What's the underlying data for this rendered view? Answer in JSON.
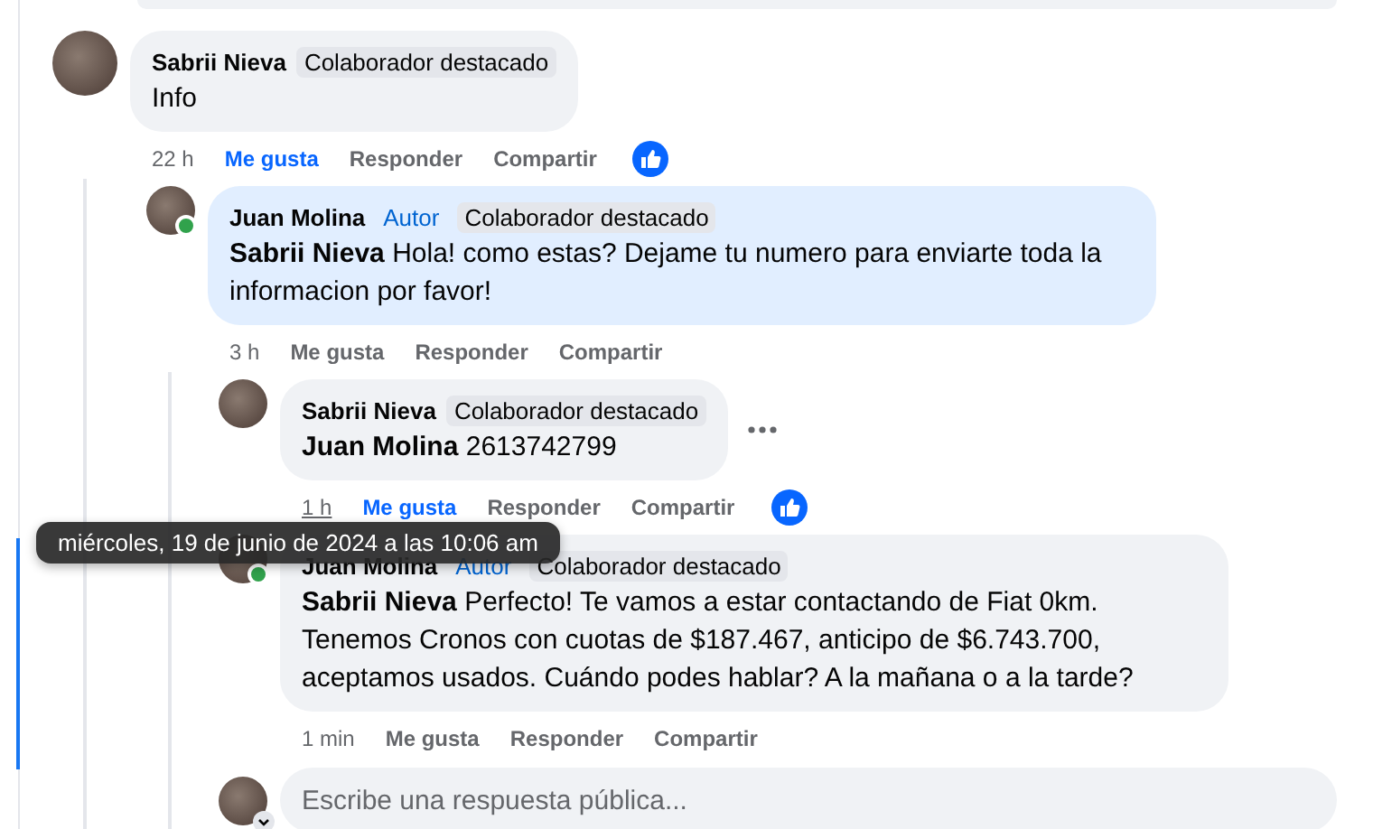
{
  "comments": [
    {
      "author": "Sabrii Nieva",
      "online": false,
      "highlighted": false,
      "badges": [
        {
          "kind": "featured",
          "text": "Colaborador destacado"
        }
      ],
      "text": "Info",
      "more_menu": false,
      "time": "22 h",
      "time_hovered": false,
      "liked": true,
      "like": "Me gusta",
      "reply": "Responder",
      "share": "Compartir",
      "reaction": true,
      "children": [
        {
          "author": "Juan Molina",
          "online": true,
          "highlighted": true,
          "badges": [
            {
              "kind": "author",
              "text": "Autor"
            },
            {
              "kind": "featured",
              "text": "Colaborador destacado"
            }
          ],
          "mention": "Sabrii Nieva",
          "text": "Hola! como estas? Dejame tu numero para enviarte toda la informacion por favor!",
          "more_menu": false,
          "time": "3 h",
          "time_hovered": false,
          "liked": false,
          "like": "Me gusta",
          "reply": "Responder",
          "share": "Compartir",
          "reaction": false,
          "children": [
            {
              "author": "Sabrii Nieva",
              "online": false,
              "highlighted": false,
              "badges": [
                {
                  "kind": "featured",
                  "text": "Colaborador destacado"
                }
              ],
              "mention": "Juan Molina",
              "text": "2613742799",
              "more_menu": true,
              "time": "1 h",
              "time_hovered": true,
              "liked": true,
              "like": "Me gusta",
              "reply": "Responder",
              "share": "Compartir",
              "reaction": true
            },
            {
              "author": "Juan Molina",
              "online": true,
              "highlighted": false,
              "badges": [
                {
                  "kind": "author",
                  "text": "Autor"
                },
                {
                  "kind": "featured",
                  "text": "Colaborador destacado"
                }
              ],
              "mention": "Sabrii Nieva",
              "text": "Perfecto! Te vamos a estar contactando de Fiat 0km. Tenemos Cronos con cuotas de $187.467, anticipo de $6.743.700, aceptamos usados. Cuándo podes hablar? A la mañana o a la tarde?",
              "more_menu": false,
              "time": "1 min",
              "time_hovered": false,
              "liked": false,
              "like": "Me gusta",
              "reply": "Responder",
              "share": "Compartir",
              "reaction": false
            }
          ],
          "reply_box": {
            "placeholder": "Escribe una respuesta pública..."
          }
        }
      ]
    }
  ],
  "tooltip": {
    "text": "miércoles, 19 de junio de 2024 a las 10:06 am"
  }
}
